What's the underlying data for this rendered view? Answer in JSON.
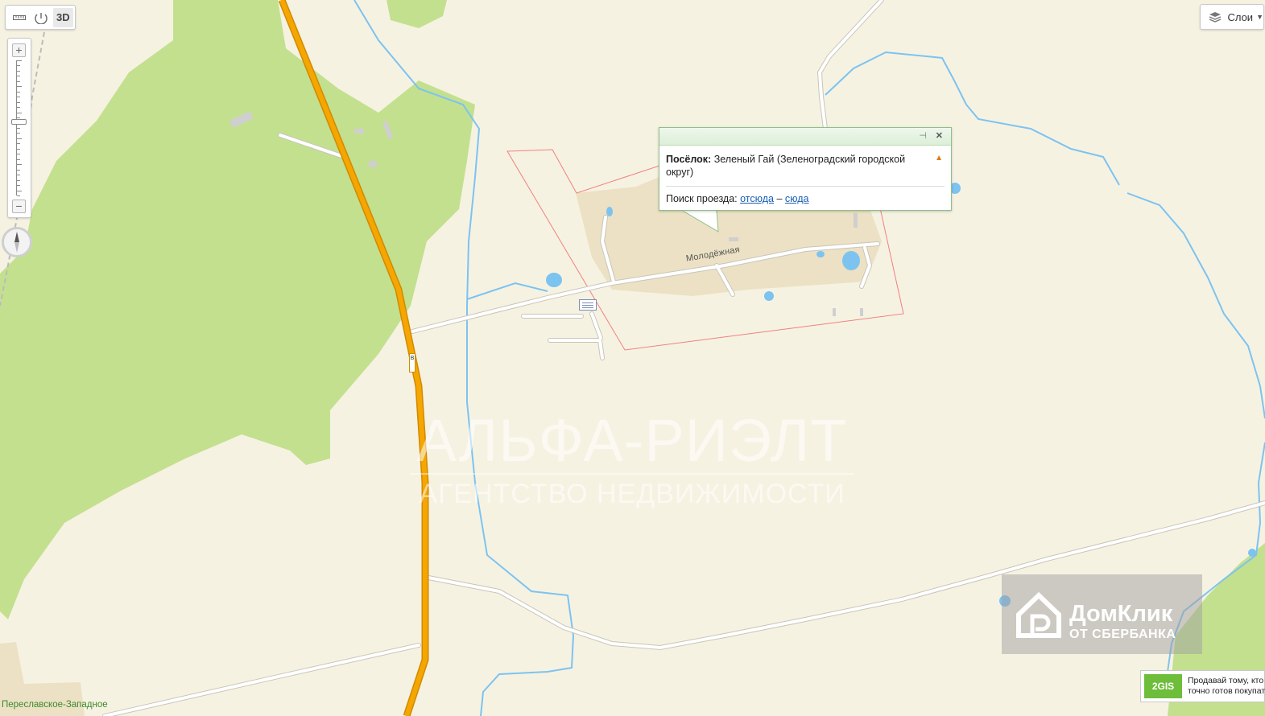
{
  "toolbar": {
    "ruler_icon": "ruler-icon",
    "measure_icon": "measure-area-icon",
    "mode_3d_label": "3D"
  },
  "zoom": {
    "plus_label": "+",
    "minus_label": "−",
    "level_fraction": 0.45
  },
  "layers": {
    "label": "Слои",
    "icon": "layers-icon"
  },
  "popup": {
    "category_label": "Посёлок:",
    "place_name": "Зеленый Гай (Зеленоградский городской округ)",
    "route_prefix": "Поиск проезда:",
    "route_from": "отсюда",
    "route_separator": "–",
    "route_to": "сюда"
  },
  "map_labels": {
    "street": "Молодёжная",
    "settlement": "Переславское-Западное",
    "road_number": "В"
  },
  "watermark": {
    "brand": "АЛЬФА-РИЭЛТ",
    "tagline": "АГЕНТСТВО НЕДВИЖИМОСТИ"
  },
  "domklik": {
    "brand": "ДомКлик",
    "sub": "ОТ СБЕРБАНКА"
  },
  "ad": {
    "logo": "2GIS",
    "line1": "Продавай тому, кто",
    "line2": "точно готов покупать"
  },
  "colors": {
    "land": "#f6f2e2",
    "forest": "#c3e08f",
    "water": "#7cc3f0",
    "highway": "#f6a600",
    "settlement": "#ece1c4",
    "boundary": "#f08080"
  }
}
